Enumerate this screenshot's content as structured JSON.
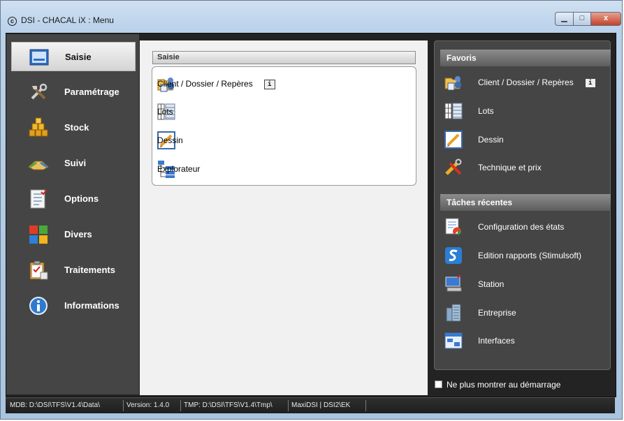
{
  "window": {
    "title": "DSI - CHACAL iX : Menu",
    "controls": {
      "minimize": "▁",
      "maximize": "□",
      "close": "x"
    }
  },
  "sidebar": {
    "items": [
      {
        "label": "Saisie",
        "icon": "form-icon",
        "active": true
      },
      {
        "label": "Paramétrage",
        "icon": "tools-icon",
        "active": false
      },
      {
        "label": "Stock",
        "icon": "stock-icon",
        "active": false
      },
      {
        "label": "Suivi",
        "icon": "handshake-icon",
        "active": false
      },
      {
        "label": "Options",
        "icon": "checklist-icon",
        "active": false
      },
      {
        "label": "Divers",
        "icon": "tiles-icon",
        "active": false
      },
      {
        "label": "Traitements",
        "icon": "clipboard-icon",
        "active": false
      },
      {
        "label": "Informations",
        "icon": "info-icon",
        "active": false
      }
    ]
  },
  "main": {
    "header": "Saisie",
    "items": [
      {
        "label": "Client / Dossier / Repères",
        "icon": "folder-user-icon",
        "info": "i"
      },
      {
        "label": "Lots",
        "icon": "grid-icon"
      },
      {
        "label": "Dessin",
        "icon": "drawing-icon"
      },
      {
        "label": "Explorateur",
        "icon": "tree-icon"
      }
    ]
  },
  "right_panel": {
    "favorites_header": "Favoris",
    "favorites": [
      {
        "label": "Client / Dossier / Repères",
        "icon": "folder-user-icon",
        "info": "i"
      },
      {
        "label": "Lots",
        "icon": "grid-icon"
      },
      {
        "label": "Dessin",
        "icon": "drawing-icon"
      },
      {
        "label": "Technique et prix",
        "icon": "tools-icon"
      }
    ],
    "recent_header": "Tâches récentes",
    "recent": [
      {
        "label": "Configuration des états",
        "icon": "report-icon"
      },
      {
        "label": "Edition rapports (Stimulsoft)",
        "icon": "stimulsoft-icon"
      },
      {
        "label": "Station",
        "icon": "computer-icon"
      },
      {
        "label": "Entreprise",
        "icon": "building-icon"
      },
      {
        "label": "Interfaces",
        "icon": "window-icon"
      }
    ],
    "startup_checkbox": {
      "label": "Ne plus montrer au démarrage",
      "checked": false
    }
  },
  "statusbar": {
    "mdb": "MDB: D:\\DSI\\TFS\\V1.4\\Data\\",
    "version": "Version: 1.4.0",
    "tmp": "TMP: D:\\DSI\\TFS\\V1.4\\Tmp\\",
    "user": "MaxiDSI | DSI2\\EK"
  }
}
